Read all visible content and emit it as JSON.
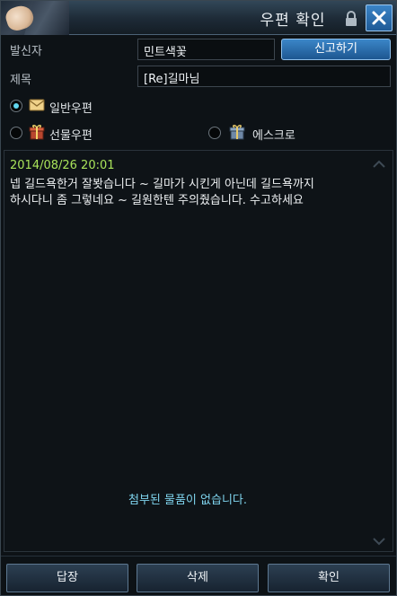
{
  "window": {
    "title": "우편 확인"
  },
  "sender": {
    "label": "발신자",
    "value": "민트색꽃"
  },
  "report_button": "신고하기",
  "subject": {
    "label": "제목",
    "value": "[Re]길마님"
  },
  "mail_types": [
    {
      "label": "일반우편",
      "checked": true,
      "icon": "envelope-icon"
    },
    {
      "label": "선물우편",
      "checked": false,
      "icon": "gift-icon"
    },
    {
      "label": "에스크로",
      "checked": false,
      "icon": "gift-icon"
    }
  ],
  "message": {
    "timestamp": "2014/08/26 20:01",
    "body": "넵 길드욕한거 잘봣습니다 ~ 길마가 시킨게 아닌데 길드욕까지\n하시다니 좀 그렇네요 ~ 길원한텐 주의줬습니다. 수고하세요",
    "attachment_note": "첨부된 물품이 없습니다."
  },
  "buttons": {
    "reply": "답장",
    "delete": "삭제",
    "confirm": "확인"
  },
  "colors": {
    "accent_blue": "#2a6fb0",
    "timestamp_green": "#a9e35a",
    "attachment_cyan": "#7fd4ee"
  }
}
